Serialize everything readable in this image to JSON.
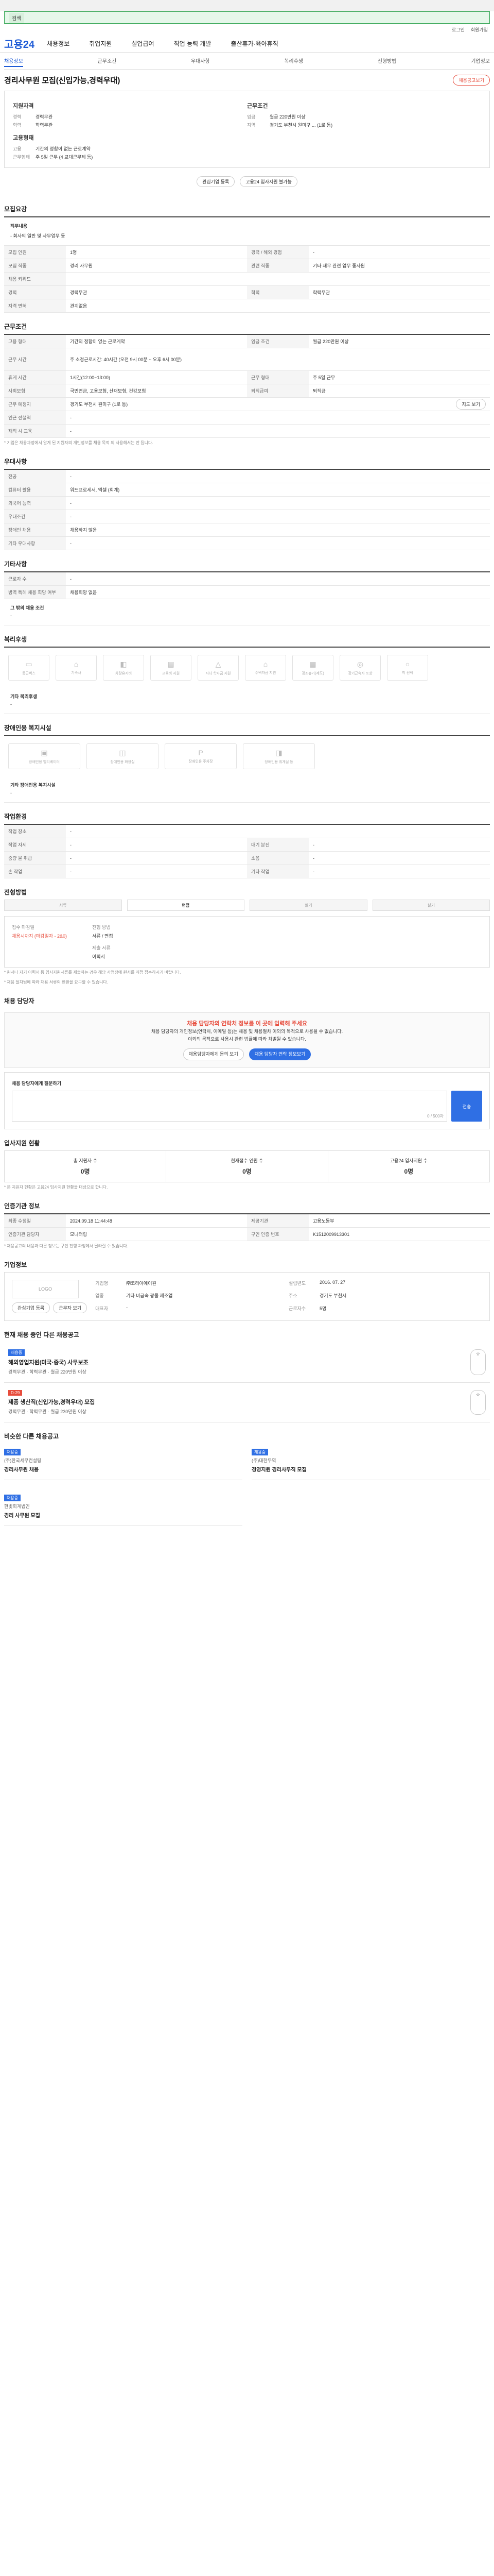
{
  "brand": {
    "name": "고용24"
  },
  "gnb": [
    "채용정보",
    "취업지원",
    "실업급여",
    "직업 능력 개발",
    "출산휴가·육아휴직"
  ],
  "tabs": [
    "채용정보",
    "근무조건",
    "우대사항",
    "복리후생",
    "전형방법",
    "기업정보"
  ],
  "job": {
    "title": "경리사무원 모집(신입가능,경력우대)",
    "save_label": "채용공고보기",
    "left": {
      "h1": "지원자격",
      "r1": [
        "경력",
        "경력무관"
      ],
      "r2": [
        "학력",
        "학력무관"
      ],
      "h2": "고용형태",
      "r3": [
        "고용",
        "기간의 정함이 없는 근로계약"
      ],
      "r4": [
        "근무형태",
        "주 5일 근무 (4 교대근무제 등)"
      ]
    },
    "right": {
      "h1": "근무조건",
      "r1": [
        "임금",
        "월급 220만원 이상"
      ],
      "r2": [
        "지역",
        "경기도 부천시 원미구 ... (1로 동)"
      ]
    },
    "btn1": "관심기업 등록",
    "btn2": "고용24 입사지원 불가능"
  },
  "sections": {
    "recruit": {
      "title": "모집요강",
      "duty_k": "직무내용",
      "duty_v": "- 회사의 일반 및 사무업무 등",
      "rows": [
        [
          "모집 인원",
          "1명",
          "경력 / 해외 경험",
          "-"
        ],
        [
          "모집 직종",
          "경리 사무원",
          "관련 직종",
          "기타 재무 관련 업무 종사원"
        ],
        [
          "채용 키워드",
          "",
          "",
          ""
        ],
        [
          "경력",
          "경력무관",
          "학력",
          "학력무관"
        ],
        [
          "자격 면허",
          "관계없음",
          "",
          ""
        ]
      ]
    },
    "work": {
      "title": "근무조건",
      "rows": [
        [
          "고용 형태",
          "기간의 정함이 없는 근로계약",
          "임금 조건",
          "월급 220만원 이상"
        ],
        [
          "근무 시간",
          "주 소정근로시간: 40시간  (오전 9시 00분 ~ 오후 6시 00분)",
          "",
          ""
        ],
        [
          "휴게 시간",
          "1시간(12:00~13:00)",
          "근무 형태",
          "주 5일 근무"
        ],
        [
          "사회보험",
          "국민연금, 고용보험, 산재보험, 건강보험",
          "퇴직급여",
          "퇴직금"
        ],
        [
          "근무 예정지",
          "경기도 부천시 원미구 (1로 동)",
          "",
          ""
        ],
        [
          "인근 전철역",
          "-",
          "",
          ""
        ],
        [
          "재직 시 교육",
          "-",
          "",
          ""
        ]
      ],
      "map_btn": "지도 보기",
      "note": "* 기업은 채용과정에서 알게 된 지원자의 개인정보를 채용 목적 외 사용해서는 안 됩니다."
    },
    "prefer": {
      "title": "우대사항",
      "rows": [
        [
          "전공",
          "-"
        ],
        [
          "컴퓨터 활용",
          "워드프로세서, 엑셀 (회계)"
        ],
        [
          "외국어 능력",
          "-"
        ],
        [
          "우대조건",
          "-"
        ],
        [
          "장애인 채용",
          "채용하지 않음"
        ],
        [
          "기타 우대사항",
          "-"
        ]
      ]
    },
    "etc": {
      "title": "기타사항",
      "rows": [
        [
          "근로자 수",
          "-"
        ],
        [
          "병역 특례 채용 희망 여부",
          "채용희망 없음"
        ]
      ],
      "extra": "그 밖의 채용 조건",
      "extra_v": "-"
    },
    "welfare": {
      "title": "복리후생",
      "items": [
        "통근버스",
        "기숙사",
        "차량유지비",
        "교육비 지원",
        "자녀 학자금 지원",
        "주택자금 지원",
        "경조휴가(제도)",
        "장기근속자 포상",
        "미 선택"
      ],
      "extra": "기타 복리후생",
      "extra_v": "-"
    },
    "disabled": {
      "title": "장애인용 복지시설",
      "items": [
        "장애인용 엘리베이터",
        "장애인용 화장실",
        "장애인용 주차장",
        "장애인용 휴게실 등"
      ],
      "extra": "기타 장애인용 복지시설",
      "extra_v": "-"
    },
    "env": {
      "title": "작업환경",
      "rows": [
        [
          "작업 장소",
          "-",
          "",
          ""
        ],
        [
          "작업 자세",
          "-",
          "대기 분진",
          "-"
        ],
        [
          "중량 물 취급",
          "-",
          "소음",
          "-"
        ],
        [
          "손 작업",
          "-",
          "기타 작업",
          "-"
        ]
      ]
    },
    "process": {
      "title": "전형방법",
      "steps": [
        "서류",
        "면접",
        "필기",
        "실기"
      ],
      "r1k": "접수 마감일",
      "r1v": "채용시까지 (마감일자 - 2&0)",
      "r2k": "전형 방법",
      "r2v": "서류 / 면접",
      "r3k": "제출 서류",
      "r3v": "이력서",
      "note1": "* 원서나 자기 이력서 등 입사지원서류를 제출하는 경우 해당 사업장에 원서를 직접 접수하시기 바랍니다.",
      "note2": "* 채용 절차법에 따라 채용 서류의 반환을 요구할 수 있습니다."
    },
    "contact": {
      "title": "채용 담당자",
      "hd": "채용 담당자의 연락처 정보를 이 곳에 입력해 주세요",
      "line1": "채용 담당자의 개인정보(연락처, 이메일 등)는 채용 및 채용절차 이외의 목적으로 사용될 수 없습니다.",
      "line2": "이외의 목적으로 사용시 관련 법률에 따라 처벌될 수 있습니다.",
      "btn1": "채용담당자에게 문의 보기",
      "btn2": "채용 담당자 연락 정보보기",
      "ask_label": "채용 담당자에게 질문하기",
      "ask_btn": "전송",
      "count": "0 / 500자"
    },
    "apply": {
      "title": "입사지원 현황",
      "items": [
        [
          "총 지원자 수",
          "0명"
        ],
        [
          "현재접수 인원 수",
          "0명"
        ],
        [
          "고용24 입사지원 수",
          "0명"
        ]
      ],
      "note": "* 본 지원자 현황은 고용24 입사지원 현황을 대상으로 합니다."
    },
    "info": {
      "title": "인증기관 정보",
      "rows": [
        [
          "최종 수정일",
          "2024.09.18 11:44:48",
          "제공기관",
          "고용노동부"
        ],
        [
          "인증기관 담당자",
          "모니터링",
          "구인 인증 번호",
          "K1512009913301"
        ]
      ],
      "note": "* 채용공고의 내용과 다른 정보는 구인 진행 과정에서 달라질 수 있습니다."
    },
    "company": {
      "title": "기업정보",
      "logo": "LOGO",
      "rows": [
        [
          "기업명",
          "㈜코리아에이원"
        ],
        [
          "업종",
          "기타 비금속 광물 제조업"
        ],
        [
          "대표자",
          "-"
        ],
        [
          "설립년도",
          "2016. 07. 27"
        ],
        [
          "주소",
          "경기도 부천시"
        ],
        [
          "근로자수",
          "5명"
        ]
      ],
      "b1": "관심기업 등록",
      "b2": "근무자 보기"
    },
    "others": {
      "title": "현재 채용 중인 다른 채용공고",
      "items": [
        {
          "tag": "채용중",
          "title": "해외영업지원(미국·중국) 사무보조",
          "meta": "경력무관 · 학력무관 · 월급 220만원 이상"
        },
        {
          "tag": "D-29",
          "title": "제품 생산직(신입가능,경력우대) 모집",
          "meta": "경력무관 · 학력무관 · 월급 230만원 이상"
        }
      ]
    },
    "similar": {
      "title": "비슷한 다른 채용공고",
      "items": [
        {
          "tag": "채용중",
          "title": "경리사무원 채용",
          "co": "(주)한국세무컨설팅"
        },
        {
          "tag": "채용중",
          "title": "경영지원 경리사무직 모집",
          "co": "(주)대한무역"
        },
        {
          "tag": "채용중",
          "title": "경리 사무원 모집",
          "co": "한빛회계법인"
        }
      ]
    }
  }
}
